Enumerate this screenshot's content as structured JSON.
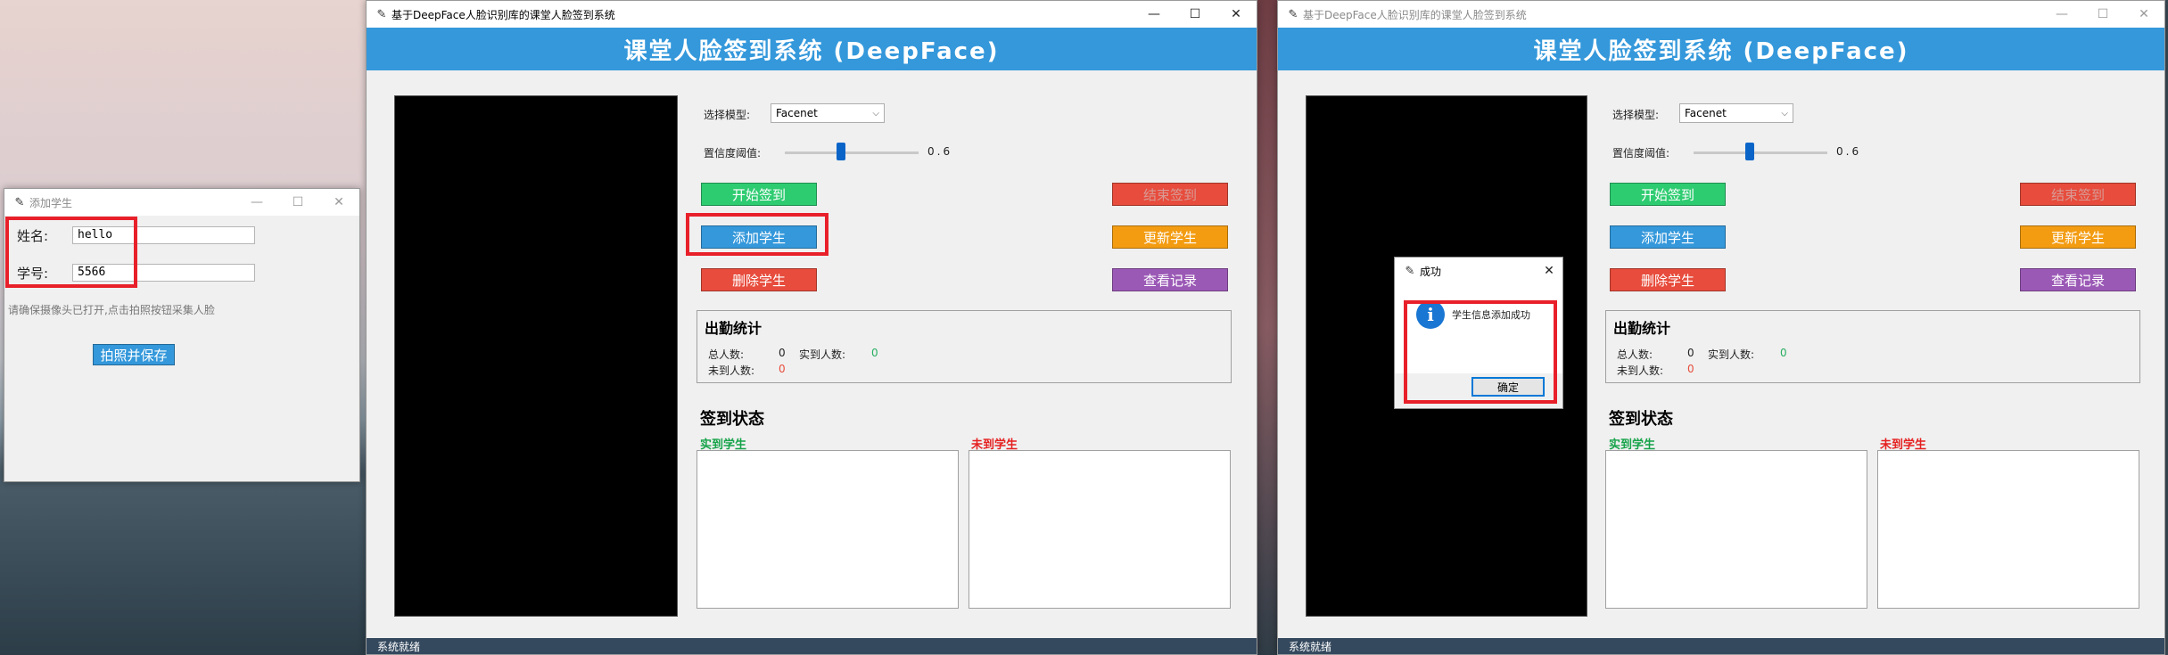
{
  "main_window": {
    "title": "基于DeepFace人脸识别库的课堂人脸签到系统",
    "header": "课堂人脸签到系统 (DeepFace)",
    "model_label": "选择模型:",
    "model_value": "Facenet",
    "threshold_label": "置信度阈值:",
    "threshold_value": "0.6",
    "threshold_fraction": 0.42,
    "buttons": {
      "start": "开始签到",
      "end": "结束签到",
      "add": "添加学生",
      "update": "更新学生",
      "delete": "删除学生",
      "records": "查看记录"
    },
    "stats": {
      "title": "出勤统计",
      "total_label": "总人数:",
      "total_value": "0",
      "present_label": "实到人数:",
      "present_value": "0",
      "absent_label": "未到人数:",
      "absent_value": "0"
    },
    "status_section": "签到状态",
    "present_list_title": "实到学生",
    "absent_list_title": "未到学生",
    "status_bar": "系统就绪"
  },
  "add_dialog": {
    "title": "添加学生",
    "name_label": "姓名:",
    "name_value": "hello",
    "id_label": "学号:",
    "id_value": "5566",
    "hint": "请确保摄像头已打开,点击拍照按钮采集人脸",
    "capture_button": "拍照并保存"
  },
  "message_box": {
    "title": "成功",
    "message": "学生信息添加成功",
    "ok_button": "确定"
  },
  "window_controls": {
    "minimize": "—",
    "maximize": "☐",
    "close": "✕"
  },
  "colors": {
    "header_blue": "#3498db",
    "green": "#2ecc71",
    "red": "#e74c3c",
    "orange": "#f39c12",
    "purple": "#9b59b6",
    "status_bar": "#34495e",
    "highlight": "#e8202a"
  }
}
